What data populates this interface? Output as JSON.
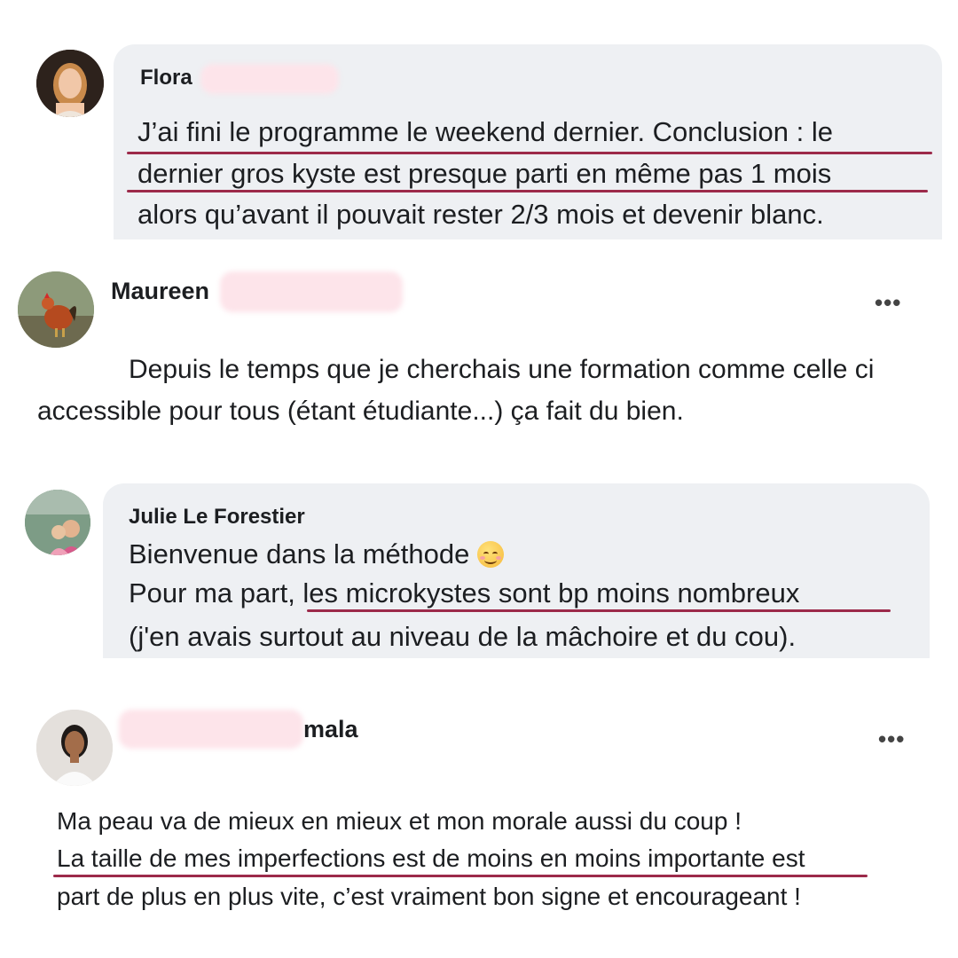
{
  "comments": [
    {
      "name": "Flora",
      "lines": [
        "J’ai fini le programme le weekend dernier. Conclusion : le",
        "dernier gros kyste est presque parti en même pas 1 mois",
        "alors qu’avant il pouvait rester 2/3 mois et devenir blanc."
      ]
    },
    {
      "name": "Maureen",
      "menu_icon": "more-options-icon",
      "lines": [
        "Depuis le temps que je cherchais une formation comme celle ci",
        "accessible pour tous (étant étudiante...) ça fait du bien."
      ]
    },
    {
      "name": "Julie Le Forestier",
      "lines": [
        "Bienvenue dans la méthode",
        "Pour ma part, les microkystes sont bp moins nombreux",
        "(j'en avais surtout au niveau de la mâchoire et du cou)."
      ],
      "emoji": "smiling-face-icon"
    },
    {
      "name": "mala",
      "menu_icon": "more-options-icon",
      "lines": [
        "Ma peau va de mieux en mieux et mon morale aussi du coup !",
        "La taille de mes imperfections est de moins en moins importante est",
        "part de plus en plus vite, c’est vraiment bon signe et encourageant !"
      ]
    }
  ],
  "colors": {
    "bubble": "#eef0f3",
    "underline": "#9c2a4a",
    "redaction": "#fde4ea"
  }
}
